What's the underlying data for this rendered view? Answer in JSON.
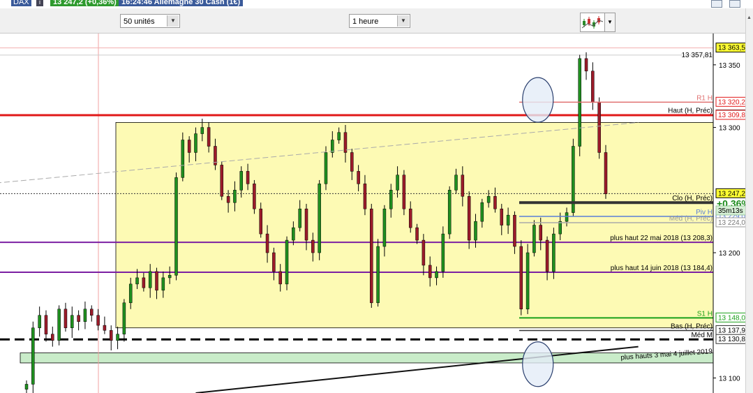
{
  "header": {
    "symbol": "DAX",
    "info_icon": "i",
    "price_change": "13 247,2 (+0,36%)",
    "time_title": "16:24:46 Allemagne 30 Cash (1€)",
    "window_buttons": [
      "minimize-icon",
      "close-icon"
    ]
  },
  "toolbar": {
    "units_select": {
      "value": "50 unités"
    },
    "period_select": {
      "value": "1 heure"
    },
    "chart_type_icon": "candlestick-chart-icon"
  },
  "colors": {
    "red_level": "#e11919",
    "purple_level": "#7b1fa2",
    "green_level": "#1aa01a",
    "zone_yellow": "#fdfab4",
    "zone_green": "#c9ecc9",
    "circle_fill": "#e4ecf7",
    "circle_stroke": "#2a3f6e",
    "candle_up": "#1f8f1f",
    "candle_down": "#9b1b2a"
  },
  "chart_data": {
    "type": "candlestick",
    "instrument": "Allemagne 30 Cash (1€)",
    "timeframe": "1 heure",
    "ylim": [
      13088,
      13375
    ],
    "y_ticks": [
      {
        "value": 13350,
        "label": "13 350"
      },
      {
        "value": 13300,
        "label": "13 300"
      },
      {
        "value": 13200,
        "label": "13 200"
      },
      {
        "value": 13100,
        "label": "13 100"
      }
    ],
    "grid": false,
    "price_path": [
      {
        "t": 0,
        "c": 13095
      },
      {
        "t": 1,
        "c": 13140
      },
      {
        "t": 2,
        "c": 13150
      },
      {
        "t": 3,
        "c": 13135
      },
      {
        "t": 4,
        "c": 13130
      },
      {
        "t": 5,
        "c": 13155
      },
      {
        "t": 6,
        "c": 13140
      },
      {
        "t": 7,
        "c": 13150
      },
      {
        "t": 8,
        "c": 13145
      },
      {
        "t": 9,
        "c": 13155
      },
      {
        "t": 10,
        "c": 13150
      },
      {
        "t": 11,
        "c": 13142
      },
      {
        "t": 12,
        "c": 13138
      },
      {
        "t": 13,
        "c": 13130
      },
      {
        "t": 14,
        "c": 13135
      },
      {
        "t": 15,
        "c": 13160
      },
      {
        "t": 16,
        "c": 13175
      },
      {
        "t": 17,
        "c": 13180
      },
      {
        "t": 18,
        "c": 13172
      },
      {
        "t": 19,
        "c": 13185
      },
      {
        "t": 20,
        "c": 13170
      },
      {
        "t": 21,
        "c": 13180
      },
      {
        "t": 22,
        "c": 13182
      },
      {
        "t": 23,
        "c": 13260
      },
      {
        "t": 24,
        "c": 13290
      },
      {
        "t": 25,
        "c": 13280
      },
      {
        "t": 26,
        "c": 13295
      },
      {
        "t": 27,
        "c": 13300
      },
      {
        "t": 28,
        "c": 13285
      },
      {
        "t": 29,
        "c": 13270
      },
      {
        "t": 30,
        "c": 13245
      },
      {
        "t": 31,
        "c": 13240
      },
      {
        "t": 32,
        "c": 13250
      },
      {
        "t": 33,
        "c": 13265
      },
      {
        "t": 34,
        "c": 13255
      },
      {
        "t": 35,
        "c": 13235
      },
      {
        "t": 36,
        "c": 13215
      },
      {
        "t": 37,
        "c": 13200
      },
      {
        "t": 38,
        "c": 13185
      },
      {
        "t": 39,
        "c": 13175
      },
      {
        "t": 40,
        "c": 13210
      },
      {
        "t": 41,
        "c": 13220
      },
      {
        "t": 42,
        "c": 13235
      },
      {
        "t": 43,
        "c": 13210
      },
      {
        "t": 44,
        "c": 13200
      },
      {
        "t": 45,
        "c": 13255
      },
      {
        "t": 46,
        "c": 13280
      },
      {
        "t": 47,
        "c": 13290
      },
      {
        "t": 48,
        "c": 13296
      },
      {
        "t": 49,
        "c": 13280
      },
      {
        "t": 50,
        "c": 13265
      },
      {
        "t": 51,
        "c": 13255
      },
      {
        "t": 52,
        "c": 13235
      },
      {
        "t": 53,
        "c": 13160
      },
      {
        "t": 54,
        "c": 13205
      },
      {
        "t": 55,
        "c": 13235
      },
      {
        "t": 56,
        "c": 13250
      },
      {
        "t": 57,
        "c": 13262
      },
      {
        "t": 58,
        "c": 13235
      },
      {
        "t": 59,
        "c": 13220
      },
      {
        "t": 60,
        "c": 13210
      },
      {
        "t": 61,
        "c": 13190
      },
      {
        "t": 62,
        "c": 13180
      },
      {
        "t": 63,
        "c": 13185
      },
      {
        "t": 64,
        "c": 13215
      },
      {
        "t": 65,
        "c": 13250
      },
      {
        "t": 66,
        "c": 13262
      },
      {
        "t": 67,
        "c": 13245
      },
      {
        "t": 68,
        "c": 13210
      },
      {
        "t": 69,
        "c": 13225
      },
      {
        "t": 70,
        "c": 13240
      },
      {
        "t": 71,
        "c": 13245
      },
      {
        "t": 72,
        "c": 13235
      },
      {
        "t": 73,
        "c": 13222
      },
      {
        "t": 74,
        "c": 13230
      },
      {
        "t": 75,
        "c": 13205
      },
      {
        "t": 76,
        "c": 13155
      },
      {
        "t": 77,
        "c": 13200
      },
      {
        "t": 78,
        "c": 13222
      },
      {
        "t": 79,
        "c": 13210
      },
      {
        "t": 80,
        "c": 13185
      },
      {
        "t": 81,
        "c": 13215
      },
      {
        "t": 82,
        "c": 13225
      },
      {
        "t": 83,
        "c": 13232
      },
      {
        "t": 84,
        "c": 13285
      },
      {
        "t": 85,
        "c": 13355
      },
      {
        "t": 86,
        "c": 13345
      },
      {
        "t": 87,
        "c": 13320
      },
      {
        "t": 88,
        "c": 13280
      },
      {
        "t": 89,
        "c": 13247
      }
    ],
    "price_labels": [
      {
        "value": 13363.5,
        "label": "13 363,5",
        "style": "yellow"
      },
      {
        "value": 13357.81,
        "label": "13 357,81",
        "style": "plain"
      },
      {
        "value": 13320.2,
        "label": "13 320,2",
        "style": "box-red"
      },
      {
        "value": 13310.1,
        "label": "13 310,1",
        "style": "box-dark"
      },
      {
        "value": 13309.8,
        "label": "13 309,8",
        "style": "box-red"
      },
      {
        "value": 13247.2,
        "label": "13 247,2",
        "style": "yellow"
      },
      {
        "value": 13229.0,
        "label": "13 229,0",
        "style": "box-blue"
      },
      {
        "value": 13224.0,
        "label": "13 224,0",
        "style": "box-grey"
      },
      {
        "value": 13148.0,
        "label": "13 148,0",
        "style": "box-green"
      },
      {
        "value": 13137.9,
        "label": "13 137,9",
        "style": "box-dark"
      },
      {
        "value": 13130.8,
        "label": "13 130,8",
        "style": "box-dark"
      }
    ],
    "change_label": "+0,36%",
    "countdown_label": "35m13s",
    "annotations": [
      {
        "text": "R1 H",
        "value": 13320.2,
        "color": "#e07070"
      },
      {
        "text": "Haut (H, Préc)",
        "value": 13310.1,
        "color": "#000000"
      },
      {
        "text": "Clo (H, Préc)",
        "value": 13240,
        "color": "#000000"
      },
      {
        "text": "Piv H",
        "value": 13229,
        "color": "#5a7fd8"
      },
      {
        "text": "Méd (H, Préc)",
        "value": 13224,
        "color": "#999999"
      },
      {
        "text": "plus haut 22 mai 2018 (13 208,3)",
        "value": 13208.3,
        "color": "#000000"
      },
      {
        "text": "plus haut 14 juin 2018 (13 184,4)",
        "value": 13184.4,
        "color": "#000000"
      },
      {
        "text": "S1 H",
        "value": 13148.0,
        "color": "#1aa01a"
      },
      {
        "text": "Bas (H, Préc)",
        "value": 13137.9,
        "color": "#000000"
      },
      {
        "text": "Méd M",
        "value": 13130.8,
        "color": "#000000"
      },
      {
        "text": "plus hauts 3 mai 4 juillet 2019",
        "value": 13118,
        "color": "#000000"
      }
    ],
    "horizontal_levels": [
      {
        "name": "red-resistance-line",
        "value": 13309.8,
        "color": "#e11919"
      },
      {
        "name": "plus-haut-22-mai-line",
        "value": 13208.3,
        "color": "#7b1fa2"
      },
      {
        "name": "plus-haut-14-juin-line",
        "value": 13184.4,
        "color": "#7b1fa2"
      },
      {
        "name": "dashed-support-line",
        "value": 13130.8,
        "color": "#000000"
      }
    ],
    "zones": [
      {
        "name": "yellow-range-zone",
        "from": 13140,
        "to": 13304
      },
      {
        "name": "green-support-zone",
        "from": 13112,
        "to": 13120
      }
    ],
    "trendlines": [
      {
        "name": "upper-dashed-trendline",
        "from": {
          "t": -6,
          "v": 13255
        },
        "to": {
          "t": 94,
          "v": 13304
        }
      },
      {
        "name": "rising-support-trendline",
        "from": {
          "t": 26,
          "v": 13088
        },
        "to": {
          "t": 94,
          "v": 13125
        }
      }
    ],
    "vertical_markers": [
      {
        "name": "session-divider",
        "t": 14
      }
    ],
    "highlight_circles": [
      {
        "name": "top-highlight-circle",
        "t": 77.5,
        "value": 13322
      },
      {
        "name": "bottom-highlight-circle",
        "t": 77.5,
        "value": 13111
      }
    ]
  }
}
